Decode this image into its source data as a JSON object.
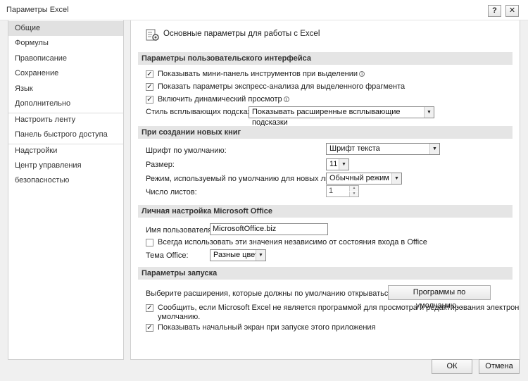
{
  "window": {
    "title": "Параметры Excel",
    "help_icon": "?",
    "close_icon": "✕"
  },
  "sidebar": {
    "items": [
      {
        "label": "Общие"
      },
      {
        "label": "Формулы"
      },
      {
        "label": "Правописание"
      },
      {
        "label": "Сохранение"
      },
      {
        "label": "Язык"
      },
      {
        "label": "Дополнительно"
      },
      {
        "label": "Настроить ленту"
      },
      {
        "label": "Панель быстрого доступа"
      },
      {
        "label": "Надстройки"
      },
      {
        "label": "Центр управления безопасностью"
      }
    ]
  },
  "main": {
    "header": "Основные параметры для работы с Excel",
    "ui_section": {
      "title": "Параметры пользовательского интерфейса",
      "options": [
        {
          "label": "Показывать мини-панель инструментов при выделении",
          "checked": true
        },
        {
          "label": "Показать параметры экспресс-анализа для выделенного фрагмента",
          "checked": true
        },
        {
          "label": "Включить динамический просмотр",
          "checked": true
        }
      ],
      "tooltip_style_label": "Стиль всплывающих подсказок:",
      "tooltip_style_value": "Показывать расширенные всплывающие подсказки"
    },
    "new_books": {
      "title": "При создании новых книг",
      "font_label": "Шрифт по умолчанию:",
      "font_value": "Шрифт текста",
      "size_label": "Размер:",
      "size_value": "11",
      "view_label": "Режим, используемый по умолчанию для новых листов:",
      "view_value": "Обычный режим",
      "sheets_label": "Число листов:",
      "sheets_value": "1"
    },
    "personal": {
      "title": "Личная настройка Microsoft Office",
      "username_label": "Имя пользователя:",
      "username_value": "MicrosoftOffice.biz",
      "always_use_label": "Всегда использовать эти значения независимо от состояния входа в Office",
      "always_use_checked": false,
      "theme_label": "Тема Office:",
      "theme_value": "Разные цвета"
    },
    "startup": {
      "title": "Параметры запуска",
      "extensions_label": "Выберите расширения, которые должны по умолчанию открываться в Excel:",
      "default_programs_button": "Программы по умолчанию...",
      "notify_label_line1": "Сообщить, если Microsoft Excel не является программой для просмотра и редактирования электронных таблиц по",
      "notify_label_line2": "умолчанию.",
      "notify_checked": true,
      "show_start_label": "Показывать начальный экран при запуске этого приложения",
      "show_start_checked": true
    }
  },
  "footer": {
    "ok_label": "ОК",
    "cancel_label": "Отмена"
  },
  "icons": {
    "check": "✓",
    "dropdown": "▼",
    "spin_up": "▲",
    "spin_down": "▼",
    "info": "i"
  }
}
